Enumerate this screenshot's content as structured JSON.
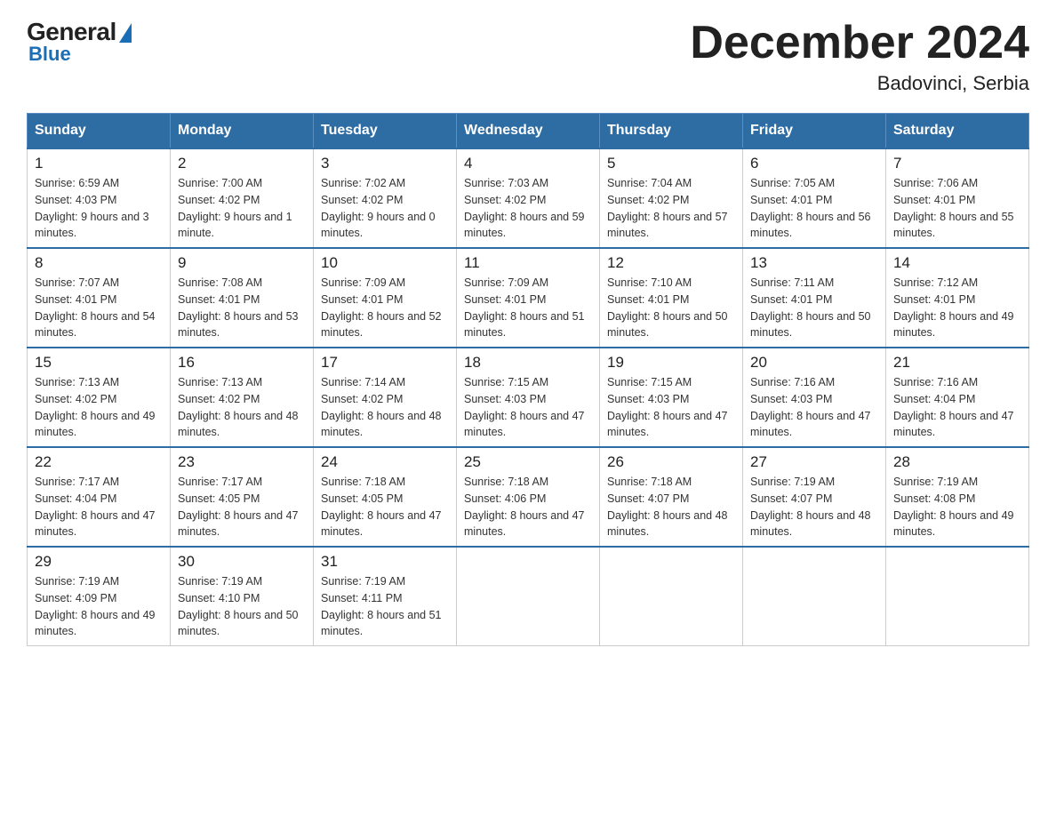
{
  "header": {
    "logo_general": "General",
    "logo_blue": "Blue",
    "month_title": "December 2024",
    "location": "Badovinci, Serbia"
  },
  "days_of_week": [
    "Sunday",
    "Monday",
    "Tuesday",
    "Wednesday",
    "Thursday",
    "Friday",
    "Saturday"
  ],
  "weeks": [
    [
      {
        "day": "1",
        "sunrise": "6:59 AM",
        "sunset": "4:03 PM",
        "daylight": "9 hours and 3 minutes."
      },
      {
        "day": "2",
        "sunrise": "7:00 AM",
        "sunset": "4:02 PM",
        "daylight": "9 hours and 1 minute."
      },
      {
        "day": "3",
        "sunrise": "7:02 AM",
        "sunset": "4:02 PM",
        "daylight": "9 hours and 0 minutes."
      },
      {
        "day": "4",
        "sunrise": "7:03 AM",
        "sunset": "4:02 PM",
        "daylight": "8 hours and 59 minutes."
      },
      {
        "day": "5",
        "sunrise": "7:04 AM",
        "sunset": "4:02 PM",
        "daylight": "8 hours and 57 minutes."
      },
      {
        "day": "6",
        "sunrise": "7:05 AM",
        "sunset": "4:01 PM",
        "daylight": "8 hours and 56 minutes."
      },
      {
        "day": "7",
        "sunrise": "7:06 AM",
        "sunset": "4:01 PM",
        "daylight": "8 hours and 55 minutes."
      }
    ],
    [
      {
        "day": "8",
        "sunrise": "7:07 AM",
        "sunset": "4:01 PM",
        "daylight": "8 hours and 54 minutes."
      },
      {
        "day": "9",
        "sunrise": "7:08 AM",
        "sunset": "4:01 PM",
        "daylight": "8 hours and 53 minutes."
      },
      {
        "day": "10",
        "sunrise": "7:09 AM",
        "sunset": "4:01 PM",
        "daylight": "8 hours and 52 minutes."
      },
      {
        "day": "11",
        "sunrise": "7:09 AM",
        "sunset": "4:01 PM",
        "daylight": "8 hours and 51 minutes."
      },
      {
        "day": "12",
        "sunrise": "7:10 AM",
        "sunset": "4:01 PM",
        "daylight": "8 hours and 50 minutes."
      },
      {
        "day": "13",
        "sunrise": "7:11 AM",
        "sunset": "4:01 PM",
        "daylight": "8 hours and 50 minutes."
      },
      {
        "day": "14",
        "sunrise": "7:12 AM",
        "sunset": "4:01 PM",
        "daylight": "8 hours and 49 minutes."
      }
    ],
    [
      {
        "day": "15",
        "sunrise": "7:13 AM",
        "sunset": "4:02 PM",
        "daylight": "8 hours and 49 minutes."
      },
      {
        "day": "16",
        "sunrise": "7:13 AM",
        "sunset": "4:02 PM",
        "daylight": "8 hours and 48 minutes."
      },
      {
        "day": "17",
        "sunrise": "7:14 AM",
        "sunset": "4:02 PM",
        "daylight": "8 hours and 48 minutes."
      },
      {
        "day": "18",
        "sunrise": "7:15 AM",
        "sunset": "4:03 PM",
        "daylight": "8 hours and 47 minutes."
      },
      {
        "day": "19",
        "sunrise": "7:15 AM",
        "sunset": "4:03 PM",
        "daylight": "8 hours and 47 minutes."
      },
      {
        "day": "20",
        "sunrise": "7:16 AM",
        "sunset": "4:03 PM",
        "daylight": "8 hours and 47 minutes."
      },
      {
        "day": "21",
        "sunrise": "7:16 AM",
        "sunset": "4:04 PM",
        "daylight": "8 hours and 47 minutes."
      }
    ],
    [
      {
        "day": "22",
        "sunrise": "7:17 AM",
        "sunset": "4:04 PM",
        "daylight": "8 hours and 47 minutes."
      },
      {
        "day": "23",
        "sunrise": "7:17 AM",
        "sunset": "4:05 PM",
        "daylight": "8 hours and 47 minutes."
      },
      {
        "day": "24",
        "sunrise": "7:18 AM",
        "sunset": "4:05 PM",
        "daylight": "8 hours and 47 minutes."
      },
      {
        "day": "25",
        "sunrise": "7:18 AM",
        "sunset": "4:06 PM",
        "daylight": "8 hours and 47 minutes."
      },
      {
        "day": "26",
        "sunrise": "7:18 AM",
        "sunset": "4:07 PM",
        "daylight": "8 hours and 48 minutes."
      },
      {
        "day": "27",
        "sunrise": "7:19 AM",
        "sunset": "4:07 PM",
        "daylight": "8 hours and 48 minutes."
      },
      {
        "day": "28",
        "sunrise": "7:19 AM",
        "sunset": "4:08 PM",
        "daylight": "8 hours and 49 minutes."
      }
    ],
    [
      {
        "day": "29",
        "sunrise": "7:19 AM",
        "sunset": "4:09 PM",
        "daylight": "8 hours and 49 minutes."
      },
      {
        "day": "30",
        "sunrise": "7:19 AM",
        "sunset": "4:10 PM",
        "daylight": "8 hours and 50 minutes."
      },
      {
        "day": "31",
        "sunrise": "7:19 AM",
        "sunset": "4:11 PM",
        "daylight": "8 hours and 51 minutes."
      },
      null,
      null,
      null,
      null
    ]
  ]
}
